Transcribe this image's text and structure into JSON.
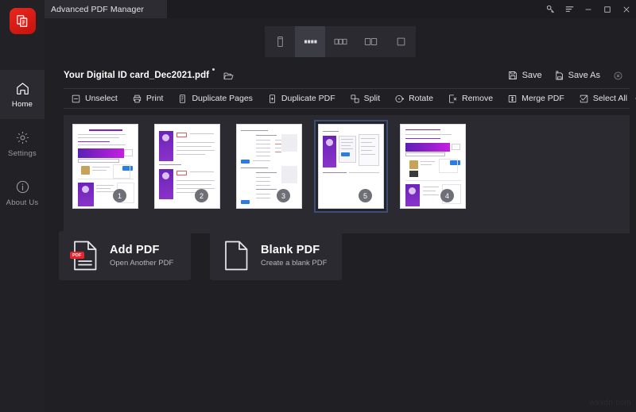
{
  "window": {
    "title": "Advanced PDF Manager",
    "controls": [
      {
        "name": "key-icon",
        "label": ""
      },
      {
        "name": "menu-icon",
        "label": ""
      },
      {
        "name": "minimize-button",
        "label": ""
      },
      {
        "name": "maximize-button",
        "label": ""
      },
      {
        "name": "close-button",
        "label": ""
      }
    ]
  },
  "sidebar": {
    "items": [
      {
        "label": "Home",
        "icon": "home-icon",
        "active": true
      },
      {
        "label": "Settings",
        "icon": "gear-icon",
        "active": false
      },
      {
        "label": "About Us",
        "icon": "info-icon",
        "active": false
      }
    ]
  },
  "view_modes": [
    {
      "name": "single-page-view",
      "active": false
    },
    {
      "name": "filmstrip-view",
      "active": true
    },
    {
      "name": "three-column-view",
      "active": false
    },
    {
      "name": "two-column-view",
      "active": false
    },
    {
      "name": "one-column-view",
      "active": false
    }
  ],
  "file": {
    "name": "Your Digital ID card_Dec2021.pdf",
    "modified_marker": "*",
    "open_folder_label": "",
    "save_label": "Save",
    "save_as_label": "Save As",
    "close_label": ""
  },
  "toolbar": {
    "items": [
      {
        "label": "Unselect",
        "icon": "unselect-icon"
      },
      {
        "label": "Print",
        "icon": "print-icon"
      },
      {
        "label": "Duplicate Pages",
        "icon": "duplicate-pages-icon"
      },
      {
        "label": "Duplicate PDF",
        "icon": "duplicate-pdf-icon"
      },
      {
        "label": "Split",
        "icon": "split-icon"
      },
      {
        "label": "Rotate",
        "icon": "rotate-icon"
      },
      {
        "label": "Remove",
        "icon": "remove-icon"
      },
      {
        "label": "Merge PDF",
        "icon": "merge-pdf-icon"
      },
      {
        "label": "Select All",
        "icon": "select-all-icon"
      }
    ],
    "overflow_label": "·"
  },
  "thumbnails": [
    {
      "page": "1",
      "selected": false,
      "art": "cover"
    },
    {
      "page": "2",
      "selected": false,
      "art": "form2"
    },
    {
      "page": "3",
      "selected": false,
      "art": "form3"
    },
    {
      "page": "5",
      "selected": true,
      "art": "panel5"
    },
    {
      "page": "4",
      "selected": false,
      "art": "cover2"
    }
  ],
  "cards": [
    {
      "title": "Add PDF",
      "subtitle": "Open Another PDF",
      "icon": "pdf-file-icon",
      "tag": "PDF"
    },
    {
      "title": "Blank PDF",
      "subtitle": "Create a blank PDF",
      "icon": "blank-file-icon",
      "tag": ""
    }
  ],
  "watermark": "wsxdn.com",
  "colors": {
    "accent_red": "#e8271f",
    "selection_blue": "#3c4e74",
    "panel": "#2a2a30",
    "background": "#202024"
  }
}
